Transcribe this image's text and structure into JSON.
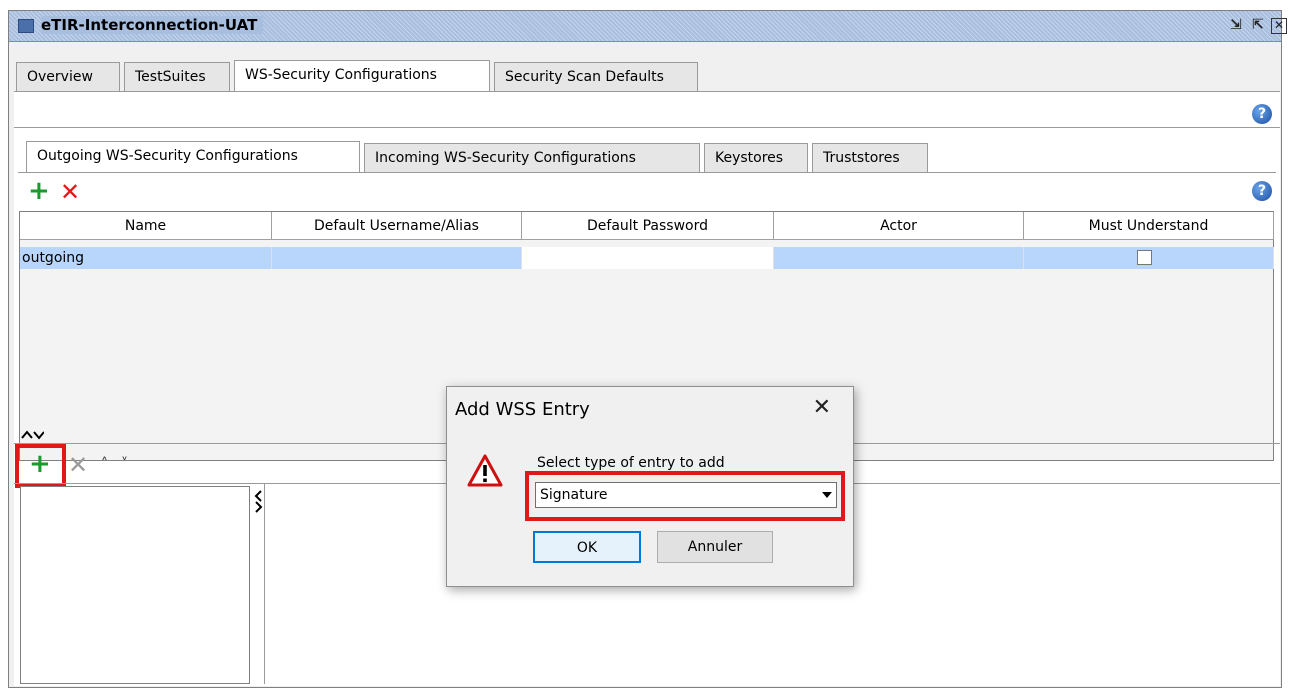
{
  "window": {
    "title": "eTIR-Interconnection-UAT",
    "buttons": [
      "restore-icon",
      "maximize-icon",
      "close-icon"
    ]
  },
  "top_tabs": [
    {
      "label": "Overview",
      "active": false
    },
    {
      "label": "TestSuites",
      "active": false
    },
    {
      "label": "WS-Security Configurations",
      "active": true
    },
    {
      "label": "Security Scan Defaults",
      "active": false
    }
  ],
  "inner_tabs": [
    {
      "label": "Outgoing WS-Security Configurations",
      "active": true
    },
    {
      "label": "Incoming WS-Security Configurations",
      "active": false
    },
    {
      "label": "Keystores",
      "active": false
    },
    {
      "label": "Truststores",
      "active": false
    }
  ],
  "help_glyph": "?",
  "toolbar": {
    "add_glyph": "+",
    "remove_glyph": "✕"
  },
  "table": {
    "headers": [
      "Name",
      "Default Username/Alias",
      "Default Password",
      "Actor",
      "Must Understand"
    ],
    "rows": [
      {
        "name": "outgoing",
        "username": "",
        "password": "",
        "actor": "",
        "must_understand": false
      }
    ]
  },
  "lower_toolbar": {
    "add_glyph": "+",
    "remove_glyph": "✕",
    "up_glyph": "˄",
    "down_glyph": "˅"
  },
  "dialog": {
    "title": "Add WSS Entry",
    "close_glyph": "✕",
    "label": "Select type of entry to add",
    "select_value": "Signature",
    "ok_label": "OK",
    "cancel_label": "Annuler"
  },
  "colors": {
    "accent_selection": "#b8d6fb",
    "highlight_red": "#e01818",
    "add_green": "#1a9a2a",
    "remove_red": "#e11818"
  }
}
